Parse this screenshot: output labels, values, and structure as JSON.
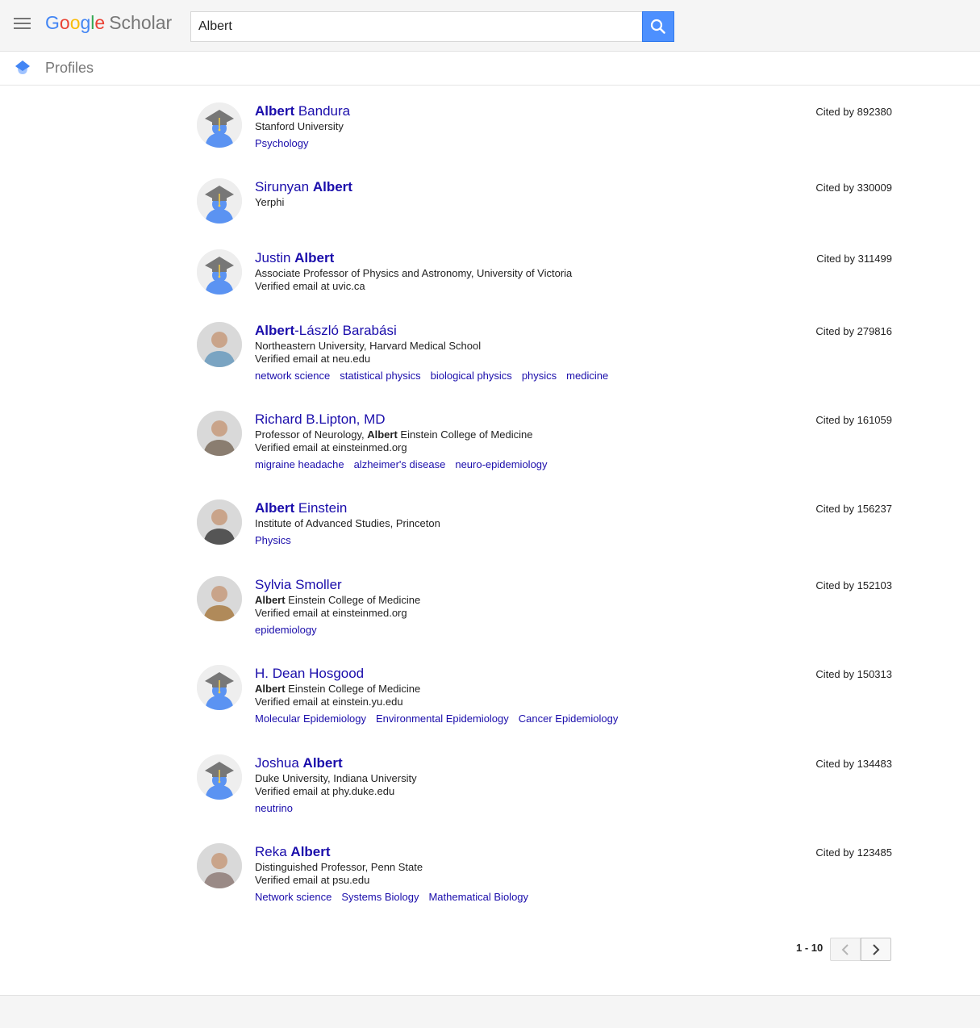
{
  "header": {
    "logo": [
      "G",
      "o",
      "o",
      "g",
      "l",
      "e"
    ],
    "logo_suffix": "Scholar",
    "search_value": "Albert"
  },
  "subbar": {
    "title": "Profiles"
  },
  "profiles": [
    {
      "name_parts": [
        [
          "Albert",
          true
        ],
        [
          " Bandura",
          false
        ]
      ],
      "affiliation_parts": [
        [
          "Stanford University",
          false
        ]
      ],
      "email": "",
      "tags": [
        "Psychology"
      ],
      "cited": "Cited by 892380",
      "avatar": "default-avatar-icon"
    },
    {
      "name_parts": [
        [
          "Sirunyan ",
          false
        ],
        [
          "Albert",
          true
        ]
      ],
      "affiliation_parts": [
        [
          "Yerphi",
          false
        ]
      ],
      "email": "",
      "tags": [],
      "cited": "Cited by 330009",
      "avatar": "default-avatar-icon"
    },
    {
      "name_parts": [
        [
          "Justin ",
          false
        ],
        [
          "Albert",
          true
        ]
      ],
      "affiliation_parts": [
        [
          "Associate Professor of Physics and Astronomy, University of Victoria",
          false
        ]
      ],
      "email": "Verified email at uvic.ca",
      "tags": [],
      "cited": "Cited by 311499",
      "avatar": "default-avatar-icon"
    },
    {
      "name_parts": [
        [
          "Albert",
          true
        ],
        [
          "-László Barabási",
          false
        ]
      ],
      "affiliation_parts": [
        [
          "Northeastern University, Harvard Medical School",
          false
        ]
      ],
      "email": "Verified email at neu.edu",
      "tags": [
        "network science",
        "statistical physics",
        "biological physics",
        "physics",
        "medicine"
      ],
      "cited": "Cited by 279816",
      "avatar": "photo-avatar"
    },
    {
      "name_parts": [
        [
          "Richard B.Lipton, MD",
          false
        ]
      ],
      "affiliation_parts": [
        [
          "Professor of Neurology, ",
          false
        ],
        [
          "Albert",
          true
        ],
        [
          " Einstein College of Medicine",
          false
        ]
      ],
      "email": "Verified email at einsteinmed.org",
      "tags": [
        "migraine headache",
        "alzheimer's disease",
        "neuro-epidemiology"
      ],
      "cited": "Cited by 161059",
      "avatar": "photo-avatar"
    },
    {
      "name_parts": [
        [
          "Albert",
          true
        ],
        [
          " Einstein",
          false
        ]
      ],
      "affiliation_parts": [
        [
          "Institute of Advanced Studies, Princeton",
          false
        ]
      ],
      "email": "",
      "tags": [
        "Physics"
      ],
      "cited": "Cited by 156237",
      "avatar": "photo-avatar"
    },
    {
      "name_parts": [
        [
          "Sylvia Smoller",
          false
        ]
      ],
      "affiliation_parts": [
        [
          "Albert",
          true
        ],
        [
          " Einstein College of Medicine",
          false
        ]
      ],
      "email": "Verified email at einsteinmed.org",
      "tags": [
        "epidemiology"
      ],
      "cited": "Cited by 152103",
      "avatar": "photo-avatar"
    },
    {
      "name_parts": [
        [
          "H. Dean Hosgood",
          false
        ]
      ],
      "affiliation_parts": [
        [
          "Albert",
          true
        ],
        [
          " Einstein College of Medicine",
          false
        ]
      ],
      "email": "Verified email at einstein.yu.edu",
      "tags": [
        "Molecular Epidemiology",
        "Environmental Epidemiology",
        "Cancer Epidemiology"
      ],
      "cited": "Cited by 150313",
      "avatar": "default-avatar-icon"
    },
    {
      "name_parts": [
        [
          "Joshua ",
          false
        ],
        [
          "Albert",
          true
        ]
      ],
      "affiliation_parts": [
        [
          "Duke University, Indiana University",
          false
        ]
      ],
      "email": "Verified email at phy.duke.edu",
      "tags": [
        "neutrino"
      ],
      "cited": "Cited by 134483",
      "avatar": "default-avatar-icon"
    },
    {
      "name_parts": [
        [
          "Reka ",
          false
        ],
        [
          "Albert",
          true
        ]
      ],
      "affiliation_parts": [
        [
          "Distinguished Professor, Penn State",
          false
        ]
      ],
      "email": "Verified email at psu.edu",
      "tags": [
        "Network science",
        "Systems Biology",
        "Mathematical Biology"
      ],
      "cited": "Cited by 123485",
      "avatar": "photo-avatar"
    }
  ],
  "pagination": {
    "label": "1 - 10"
  },
  "colors": {
    "accent": "#4d90fe",
    "link": "#1a0dab"
  }
}
